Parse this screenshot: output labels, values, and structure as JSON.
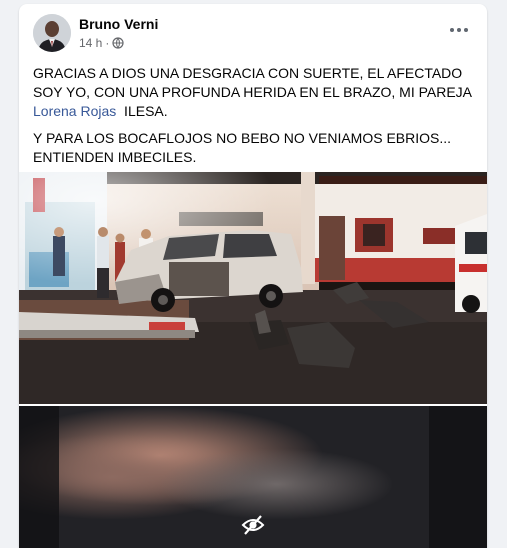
{
  "post": {
    "author_name": "Bruno Verni",
    "time": "14 h",
    "audience_icon": "globe-icon",
    "more_icon": "more-options-icon",
    "paragraph1_before": "GRACIAS A DIOS UNA DESGRACIA CON SUERTE, EL AFECTADO SOY YO, CON UNA PROFUNDA HERIDA EN EL BRAZO, MI PAREJA ",
    "mention": "Lorena Rojas",
    "paragraph1_after": "  ILESA.",
    "paragraph2": "Y PARA LOS BOCAFLOJOS NO BEBO NO VENIAMOS EBRIOS... ENTIENDEN IMBECILES."
  },
  "media": {
    "photo1_icon": "car-crash-photo",
    "photo2_icon": "hidden-content-icon",
    "link_color": "#385898"
  }
}
